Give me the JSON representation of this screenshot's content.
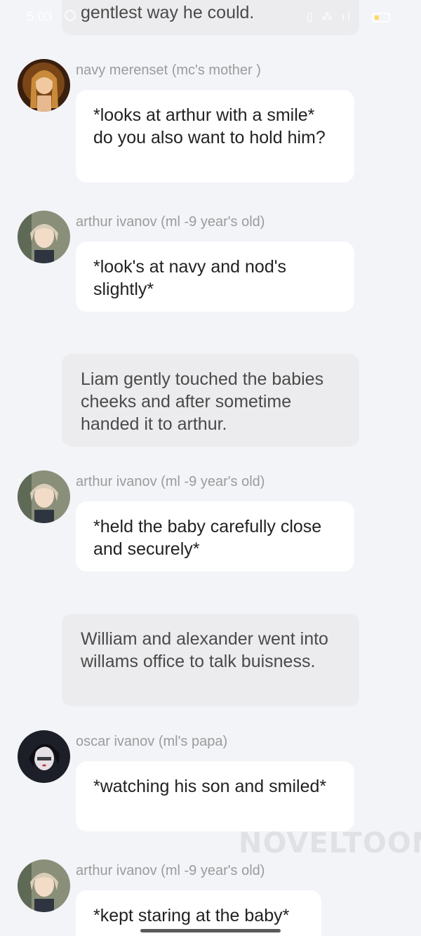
{
  "status_bar": {
    "time": "5:03",
    "icons": "vibrate-icon, data-icon, signal-icon, battery-icon"
  },
  "messages": {
    "narration_0": "gentlest way he could.",
    "msg1": {
      "name": "navy merenset (mc's mother )",
      "text": "*looks at arthur with a smile* do you also want to hold him?"
    },
    "msg2": {
      "name": "arthur ivanov (ml -9 year's old)",
      "text": "*look's at navy and nod's slightly*"
    },
    "narration_1": "Liam gently touched the babies cheeks and after sometime handed it to arthur.",
    "msg3": {
      "name": "arthur ivanov (ml -9 year's old)",
      "text": "*held the baby carefully close and securely*"
    },
    "narration_2": "William and alexander went into willams office to talk buisness.",
    "msg4": {
      "name": "oscar ivanov (ml's papa)",
      "text": "*watching his son and smiled*"
    },
    "msg5": {
      "name": "arthur ivanov (ml -9 year's old)",
      "text": "*kept staring at the baby*"
    }
  },
  "watermark": "NOVELTOON",
  "colors": {
    "background": "#f3f4f8",
    "narration_bg": "#ececee",
    "bubble_bg": "#ffffff",
    "name_text": "#9b9b9b"
  }
}
